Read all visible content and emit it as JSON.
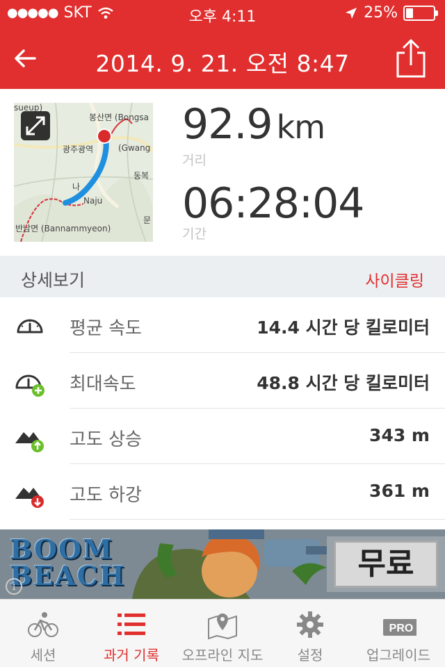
{
  "status_bar": {
    "carrier": "SKT",
    "time": "오후 4:11",
    "battery": "25%",
    "battery_level": 0.25
  },
  "nav": {
    "title": "2014. 9. 21. 오전 8:47",
    "back_icon": "arrow-left-icon",
    "share_icon": "share-icon"
  },
  "summary": {
    "map_labels": [
      "sueup)",
      "봉산면 (Bongsa",
      "광주광역",
      "(Gwang",
      "동복",
      "나",
      "Naju",
      "문",
      "반남면 (Bannammyeon)"
    ],
    "distance_value": "92.9",
    "distance_unit": "km",
    "distance_label": "거리",
    "duration_value": "06:28:04",
    "duration_label": "기간"
  },
  "details": {
    "title": "상세보기",
    "activity_type": "사이클링",
    "rows": [
      {
        "icon": "speedometer-icon",
        "label": "평균 속도",
        "value": "14.4 시간 당 킬로미터"
      },
      {
        "icon": "speedometer-plus-icon",
        "label": "최대속도",
        "value": "48.8 시간 당 킬로미터"
      },
      {
        "icon": "elevation-up-icon",
        "label": "고도 상승",
        "value": "343 m"
      },
      {
        "icon": "elevation-down-icon",
        "label": "고도 하강",
        "value": "361 m"
      }
    ]
  },
  "ad": {
    "title_line1": "BOOM",
    "title_line2": "BEACH",
    "free_label": "무료",
    "info_glyph": "i"
  },
  "tabs": [
    {
      "label": "세션",
      "icon": "cyclist-icon",
      "active": false
    },
    {
      "label": "과거 기록",
      "icon": "list-icon",
      "active": true
    },
    {
      "label": "오프라인 지도",
      "icon": "map-pin-icon",
      "active": false
    },
    {
      "label": "설정",
      "icon": "gear-icon",
      "active": false
    },
    {
      "label": "업그레이드",
      "icon": "pro-badge-icon",
      "active": false,
      "badge": "PRO"
    }
  ],
  "colors": {
    "brand_red": "#e12e2e",
    "route_blue": "#1f8fe0",
    "up_green": "#6bbf2a",
    "down_red": "#d92b2b"
  }
}
